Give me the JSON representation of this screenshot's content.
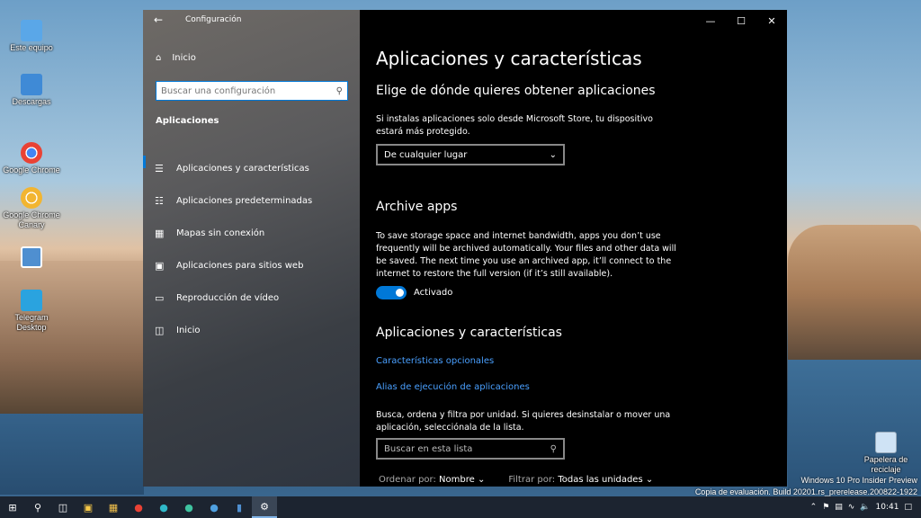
{
  "desktop": {
    "icons": [
      {
        "label": "Este equipo",
        "color": "#5aa7e8"
      },
      {
        "label": "Descargas",
        "color": "#3f8ad6"
      },
      {
        "label": "Google Chrome",
        "color": "#e94235"
      },
      {
        "label": "Google Chrome Canary",
        "color": "#f2b531"
      },
      {
        "label": "",
        "color": "#4f8fd0"
      },
      {
        "label": "Telegram Desktop",
        "color": "#2aa3df"
      }
    ],
    "recycle_bin": "Papelera de reciclaje",
    "watermark_line1": "Windows 10 Pro Insider Preview",
    "watermark_line2": "Copia de evaluación. Build 20201.rs_prerelease.200822-1922"
  },
  "window": {
    "title": "Configuración",
    "sidebar": {
      "home": "Inicio",
      "search_placeholder": "Buscar una configuración",
      "section": "Aplicaciones",
      "items": [
        {
          "label": "Aplicaciones y características",
          "icon": "list-icon"
        },
        {
          "label": "Aplicaciones predeterminadas",
          "icon": "default-apps-icon"
        },
        {
          "label": "Mapas sin conexión",
          "icon": "map-icon"
        },
        {
          "label": "Aplicaciones para sitios web",
          "icon": "website-icon"
        },
        {
          "label": "Reproducción de vídeo",
          "icon": "video-icon"
        },
        {
          "label": "Inicio",
          "icon": "startup-icon"
        }
      ]
    },
    "content": {
      "title": "Aplicaciones y características",
      "source_heading": "Elige de dónde quieres obtener aplicaciones",
      "source_desc": "Si instalas aplicaciones solo desde Microsoft Store, tu dispositivo estará más protegido.",
      "source_value": "De cualquier lugar",
      "archive_heading": "Archive apps",
      "archive_desc": "To save storage space and internet bandwidth, apps you don’t use frequently will be archived automatically. Your files and other data will be saved. The next time you use an archived app, it’ll connect to the internet to restore the full version (if it’s still available).",
      "archive_toggle": "Activado",
      "features_heading": "Aplicaciones y características",
      "link_optional": "Características opcionales",
      "link_alias": "Alias de ejecución de aplicaciones",
      "list_desc": "Busca, ordena y filtra por unidad. Si quieres desinstalar o mover una aplicación, selecciónala de la lista.",
      "list_search_placeholder": "Buscar en esta lista",
      "sort_label": "Ordenar por:",
      "sort_value": "Nombre",
      "filter_label": "Filtrar por:",
      "filter_value": "Todas las unidades"
    }
  },
  "taskbar": {
    "time": "10:41"
  }
}
